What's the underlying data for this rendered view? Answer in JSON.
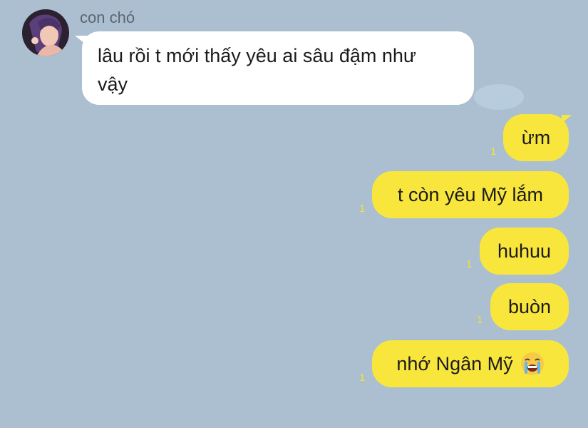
{
  "chat": {
    "incoming": {
      "sender_name": "con chó",
      "line1": "lâu rồi t mới thấy yêu ai sâu đậm như",
      "line2": "vậy"
    },
    "outgoing": [
      {
        "text": "ừm",
        "read_count": "1"
      },
      {
        "text": "t còn yêu Mỹ lắm",
        "read_count": "1"
      },
      {
        "text": "huhuu",
        "read_count": "1"
      },
      {
        "text": "buòn",
        "read_count": "1"
      },
      {
        "text": "nhớ Ngân Mỹ",
        "read_count": "1",
        "emoji": "loudly-crying-face-icon"
      }
    ]
  },
  "colors": {
    "background": "#abbfd1",
    "incoming_bubble": "#ffffff",
    "outgoing_bubble": "#f9e63d",
    "read_count": "#f2df3a"
  }
}
